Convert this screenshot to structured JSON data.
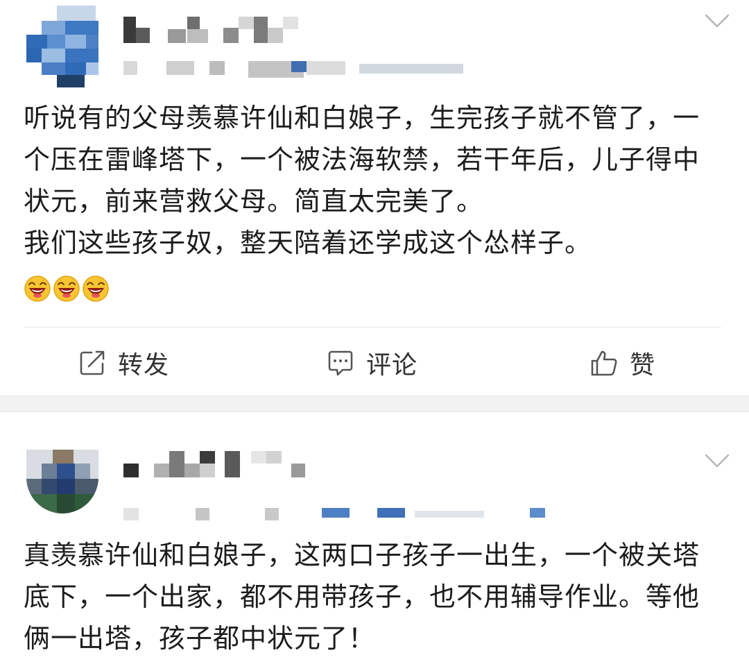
{
  "posts": [
    {
      "text": "听说有的父母羡慕许仙和白娘子，生完孩子就不管了，一个压在雷峰塔下，一个被法海软禁，若干年后，儿子得中状元，前来营救父母。简直太完美了。\n我们这些孩子奴，整天陪着还学成这个怂样子。",
      "emoji": [
        "laughing-emoji",
        "laughing-emoji",
        "laughing-emoji"
      ],
      "actions": {
        "repost": "转发",
        "comment": "评论",
        "like": "赞"
      }
    },
    {
      "text": "真羡慕许仙和白娘子，这两口子孩子一出生，一个被关塔底下，一个出家，都不用带孩子，也不用辅导作业。等他俩一出塔，孩子都中状元了！"
    }
  ],
  "icons": {
    "more": "chevron-down-icon",
    "repost": "repost-icon",
    "comment": "comment-icon",
    "like": "thumbs-up-icon"
  },
  "colors": {
    "text": "#1c1c1c",
    "action_text": "#333333",
    "separator": "#f2f2f2",
    "icon": "#555555"
  }
}
